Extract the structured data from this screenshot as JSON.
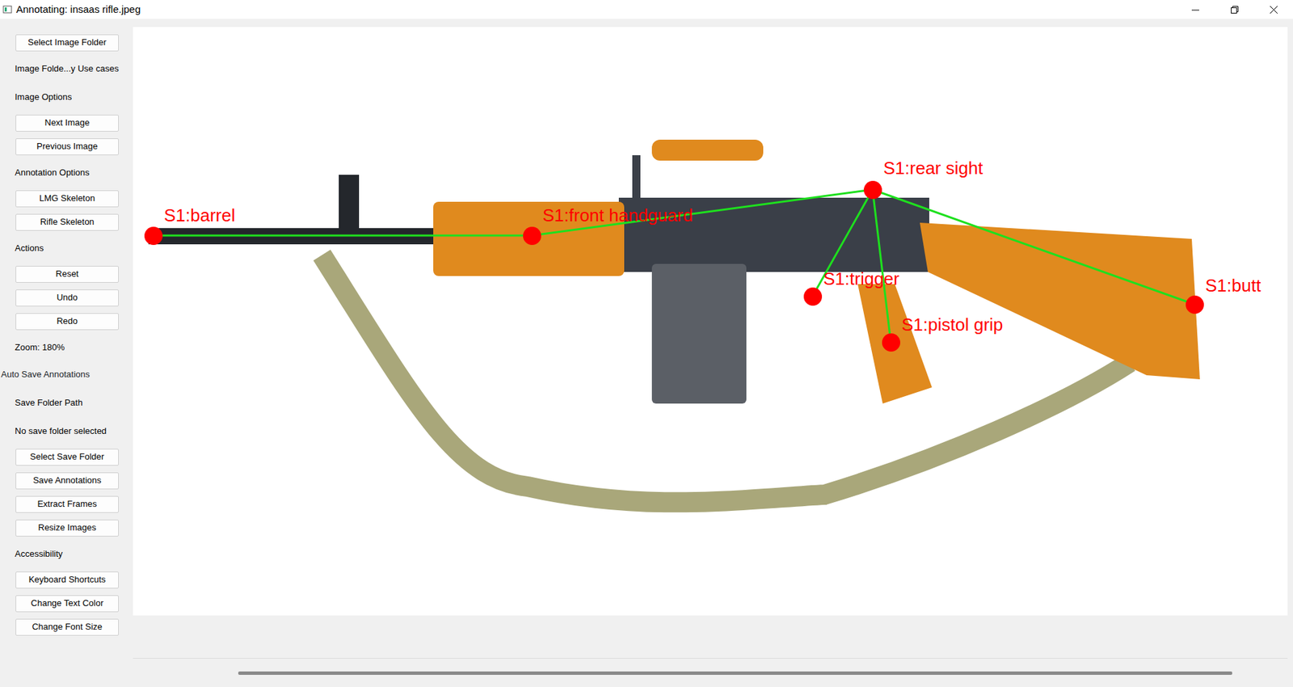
{
  "window": {
    "title": "Annotating: insaas rifle.jpeg"
  },
  "sidebar": {
    "items": [
      {
        "kind": "button",
        "label": "Select Image Folder"
      },
      {
        "kind": "label",
        "label": "Image Folde...y Use cases"
      },
      {
        "kind": "label",
        "label": "Image Options"
      },
      {
        "kind": "button",
        "label": "Next Image"
      },
      {
        "kind": "button",
        "label": "Previous Image"
      },
      {
        "kind": "label",
        "label": "Annotation Options"
      },
      {
        "kind": "button",
        "label": "LMG Skeleton"
      },
      {
        "kind": "button",
        "label": "Rifle Skeleton"
      },
      {
        "kind": "label",
        "label": "Actions"
      },
      {
        "kind": "button",
        "label": "Reset"
      },
      {
        "kind": "button",
        "label": "Undo"
      },
      {
        "kind": "button",
        "label": "Redo"
      },
      {
        "kind": "label",
        "label": "Zoom: 180%"
      },
      {
        "kind": "checkbox",
        "label": "Auto Save Annotations",
        "checked": false
      },
      {
        "kind": "label",
        "label": "Save Folder Path"
      },
      {
        "kind": "label",
        "label": "No save folder selected"
      },
      {
        "kind": "button",
        "label": "Select Save Folder"
      },
      {
        "kind": "button",
        "label": "Save Annotations"
      },
      {
        "kind": "button",
        "label": "Extract Frames"
      },
      {
        "kind": "button",
        "label": "Resize Images"
      },
      {
        "kind": "label",
        "label": "Accessibility"
      },
      {
        "kind": "button",
        "label": "Keyboard Shortcuts"
      },
      {
        "kind": "button",
        "label": "Change Text Color"
      },
      {
        "kind": "button",
        "label": "Change Font Size"
      }
    ]
  },
  "canvas": {
    "keypoints": [
      {
        "label": "S1:barrel"
      },
      {
        "label": "S1:front handguard"
      },
      {
        "label": "S1:rear sight"
      },
      {
        "label": "S1:trigger"
      },
      {
        "label": "S1:pistol grip"
      },
      {
        "label": "S1:butt"
      }
    ]
  }
}
